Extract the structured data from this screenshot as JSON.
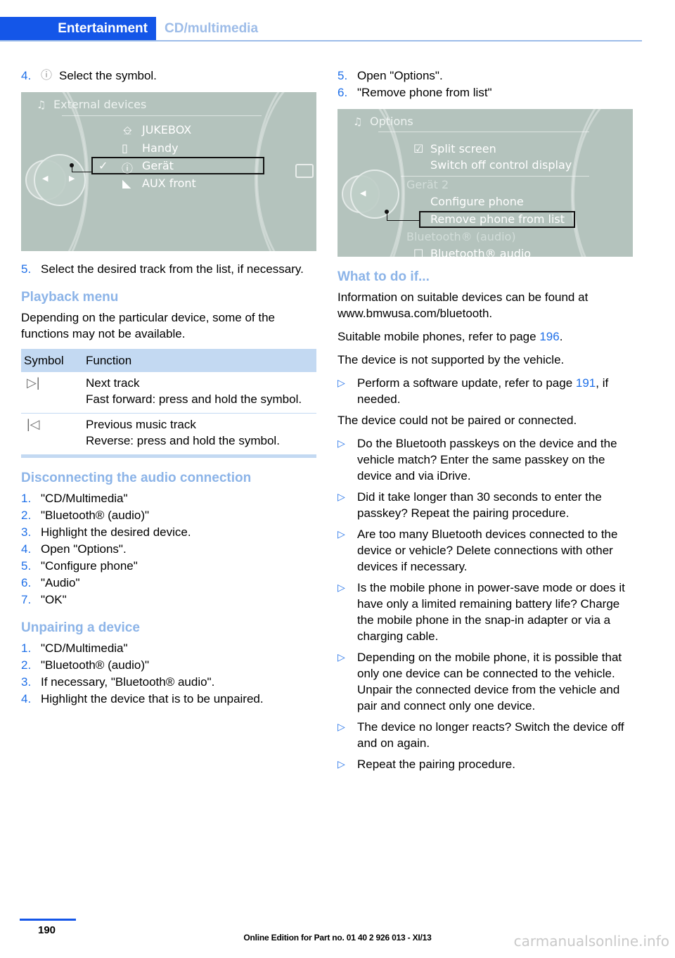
{
  "header": {
    "active_tab": "Entertainment",
    "inactive_tab": "CD/multimedia",
    "accent_blue": "#1456e8",
    "muted_blue": "#9dbce8"
  },
  "left_column": {
    "step4": {
      "num": "4.",
      "symbol": "bluetooth-circled-icon",
      "text": "Select the symbol."
    },
    "idrive_external_devices": {
      "title": "External devices",
      "title_icon": "media-note-icon",
      "items": [
        {
          "label": "JUKEBOX",
          "icon": "usb-icon",
          "selected": false,
          "checked": false
        },
        {
          "label": "Handy",
          "icon": "phone-icon",
          "selected": false,
          "checked": false
        },
        {
          "label": "Gerät",
          "icon": "bluetooth-icon",
          "selected": true,
          "checked": true
        },
        {
          "label": "AUX front",
          "icon": "aux-plug-icon",
          "selected": false,
          "checked": false
        }
      ]
    },
    "step5": {
      "num": "5.",
      "text": "Select the desired track from the list, if necessary."
    },
    "playback_menu": {
      "heading": "Playback menu",
      "intro": "Depending on the particular device, some of the functions may not be available.",
      "table": {
        "columns": [
          "Symbol",
          "Function"
        ],
        "rows": [
          {
            "symbol": "next-track-icon",
            "symbol_glyph": "▷|",
            "lines": [
              "Next track",
              "Fast forward: press and hold the symbol."
            ]
          },
          {
            "symbol": "previous-track-icon",
            "symbol_glyph": "|◁",
            "lines": [
              "Previous music track",
              "Reverse: press and hold the symbol."
            ]
          }
        ]
      }
    },
    "disconnecting": {
      "heading": "Disconnecting the audio connection",
      "steps": [
        {
          "num": "1.",
          "text": "\"CD/Multimedia\""
        },
        {
          "num": "2.",
          "text": "\"Bluetooth® (audio)\""
        },
        {
          "num": "3.",
          "text": "Highlight the desired device."
        },
        {
          "num": "4.",
          "text": "Open \"Options\"."
        },
        {
          "num": "5.",
          "text": "\"Configure phone\""
        },
        {
          "num": "6.",
          "text": "\"Audio\""
        },
        {
          "num": "7.",
          "text": "\"OK\""
        }
      ]
    },
    "unpairing": {
      "heading": "Unpairing a device",
      "steps": [
        {
          "num": "1.",
          "text": "\"CD/Multimedia\""
        },
        {
          "num": "2.",
          "text": "\"Bluetooth® (audio)\""
        },
        {
          "num": "3.",
          "text": "If necessary, \"Bluetooth® audio\"."
        },
        {
          "num": "4.",
          "text": "Highlight the device that is to be unpaired."
        }
      ]
    }
  },
  "right_column": {
    "steps_top": [
      {
        "num": "5.",
        "text": "Open \"Options\"."
      },
      {
        "num": "6.",
        "text": "\"Remove phone from list\""
      }
    ],
    "idrive_options": {
      "title": "Options",
      "title_icon": "media-note-plus-icon",
      "items": [
        {
          "label": "Split screen",
          "checkbox": "checked",
          "dim": false,
          "selected": false
        },
        {
          "label": "Switch off control display",
          "checkbox": "none",
          "dim": false,
          "selected": false
        },
        {
          "label": "Gerät 2",
          "checkbox": "none",
          "dim": true,
          "selected": false
        },
        {
          "label": "Configure phone",
          "checkbox": "none",
          "dim": false,
          "selected": false
        },
        {
          "label": "Remove phone from list",
          "checkbox": "none",
          "dim": false,
          "selected": true
        },
        {
          "label": "Bluetooth® (audio)",
          "checkbox": "none",
          "dim": true,
          "selected": false
        },
        {
          "label": "Bluetooth® audio",
          "checkbox": "unchecked",
          "dim": false,
          "selected": false
        }
      ]
    },
    "what_to_do": {
      "heading": "What to do if...",
      "para1": "Information on suitable devices can be found at www.bmwusa.com/bluetooth.",
      "para2_pre": "Suitable mobile phones, refer to page ",
      "para2_page": "196",
      "para2_post": ".",
      "para3": "The device is not supported by the vehicle.",
      "bullet1_pre": "Perform a software update, refer to page ",
      "bullet1_page": "191",
      "bullet1_post": ", if needed.",
      "para4": "The device could not be paired or connected.",
      "bullets": [
        "Do the Bluetooth passkeys on the device and the vehicle match? Enter the same passkey on the device and via iDrive.",
        "Did it take longer than 30 seconds to enter the passkey? Repeat the pairing procedure.",
        "Are too many Bluetooth devices connected to the device or vehicle? Delete connections with other devices if necessary.",
        "Is the mobile phone in power-save mode or does it have only a limited remaining battery life? Charge the mobile phone in the snap-in adapter or via a charging cable.",
        "Depending on the mobile phone, it is possible that only one device can be connected to the vehicle. Unpair the connected device from the vehicle and pair and connect only one device.",
        "The device no longer reacts? Switch the device off and on again.",
        "Repeat the pairing procedure."
      ]
    }
  },
  "footer": {
    "page_number": "190",
    "edition": "Online Edition for Part no. 01 40 2 926 013 - XI/13",
    "watermark": "carmanualsonline.info"
  }
}
